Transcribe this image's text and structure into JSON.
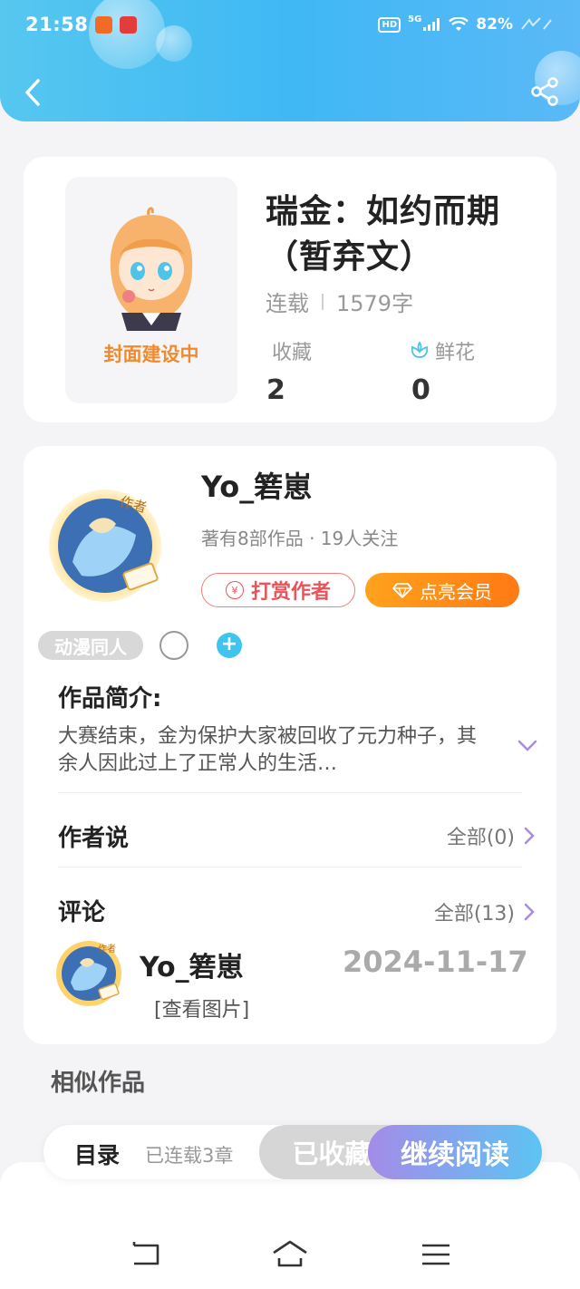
{
  "status_bar": {
    "time": "21:58",
    "network": "5G",
    "battery": "82%",
    "hd": "HD"
  },
  "book": {
    "cover_text": "封面建设中",
    "title": "瑞金：如约而期（暂弃文）",
    "status": "连载",
    "word_count": "1579字",
    "favorites_label": "收藏",
    "favorites_value": "2",
    "flowers_label": "鲜花",
    "flowers_value": "0"
  },
  "author": {
    "name": "Yo_箬崽",
    "meta": "著有8部作品 · 19人关注",
    "tip_label": "打赏作者",
    "tip_icon": "¥",
    "vip_label": "点亮会员",
    "tag": "动漫同人",
    "plus": "+"
  },
  "intro": {
    "title": "作品简介:",
    "summary": "大赛结束，金为保护大家被回收了元力种子，其余人因此过上了正常人的生活…"
  },
  "author_says": {
    "title": "作者说",
    "link": "全部(0)"
  },
  "comments": {
    "title": "评论",
    "link": "全部(13)",
    "items": [
      {
        "user": "Yo_箬崽",
        "date": "2024-11-17",
        "text": "[查看图片]"
      }
    ]
  },
  "similar": {
    "title": "相似作品"
  },
  "action_bar": {
    "toc": "目录",
    "chapters": "已连载3章",
    "favorited": "已收藏",
    "continue": "继续阅读"
  },
  "colors": {
    "header": "#3fb8f4",
    "accent_orange": "#ff7a14",
    "tip_red": "#e8545a",
    "cover_text": "#f08a2c"
  }
}
